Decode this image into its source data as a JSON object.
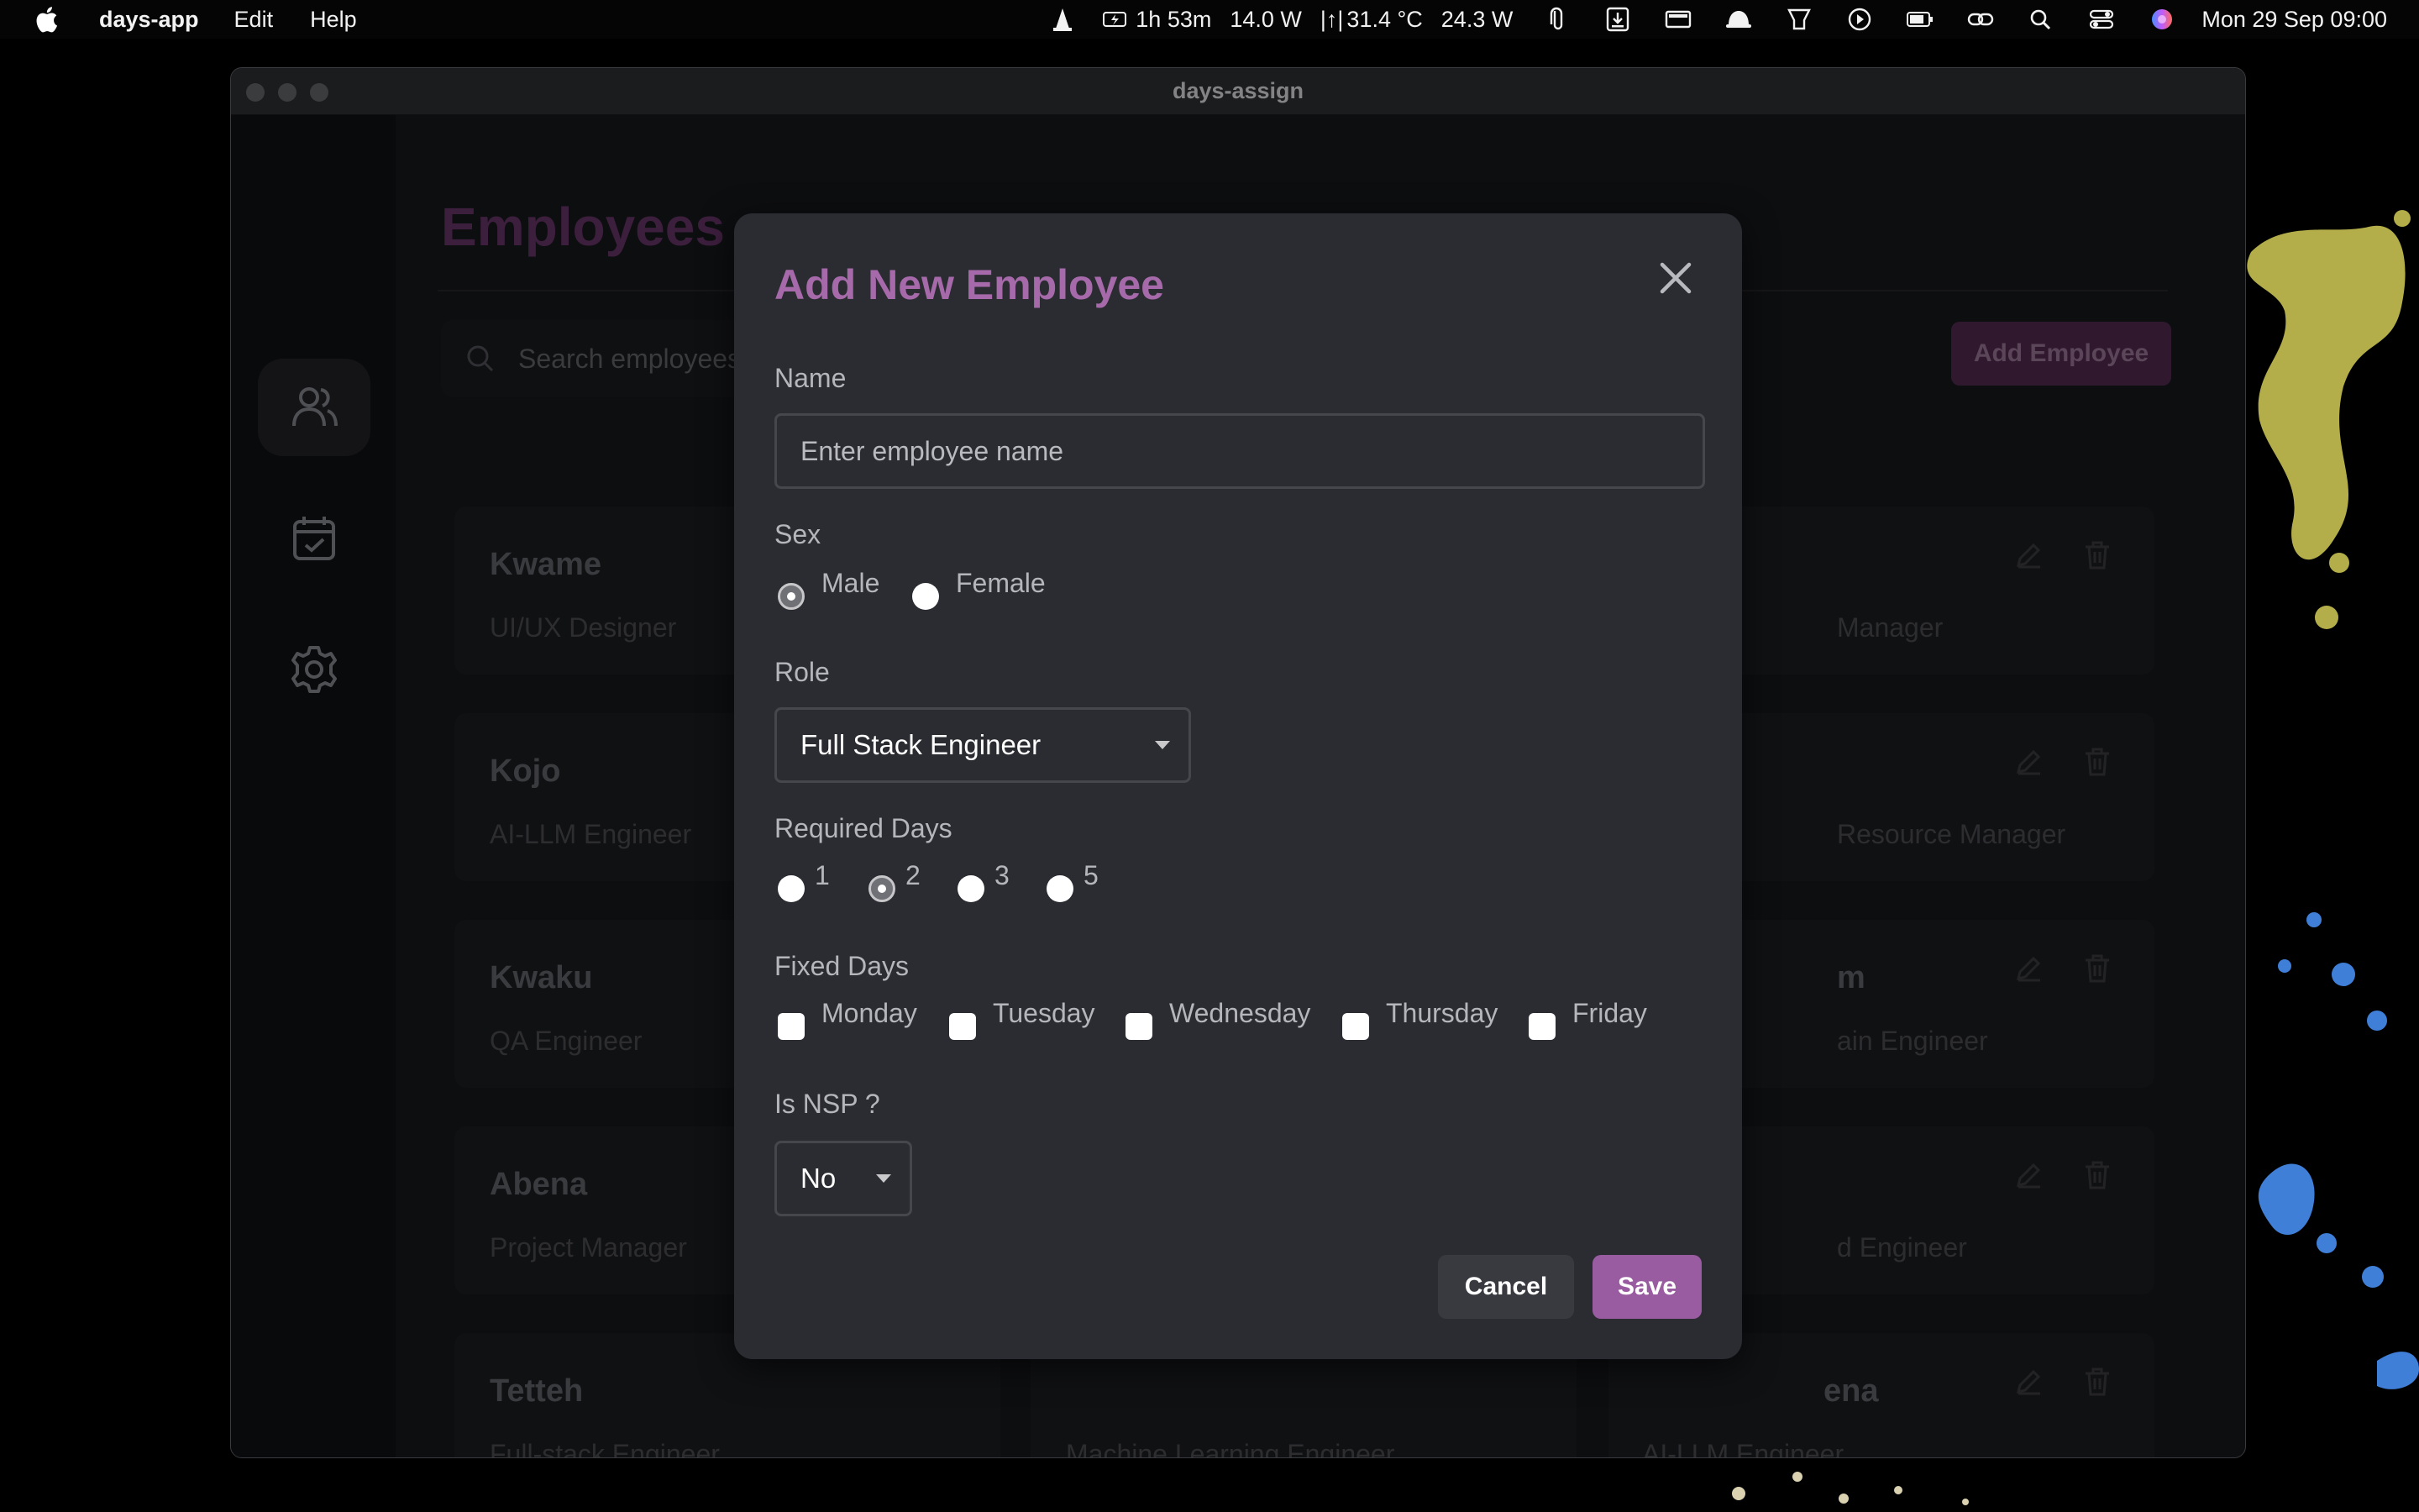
{
  "menubar": {
    "app_name": "days-app",
    "menus": [
      "Edit",
      "Help"
    ],
    "status": {
      "battery_time": "1h 53m",
      "power_in": "14.0 W",
      "temperature": "31.4 °C",
      "power_out": "24.3 W",
      "datetime": "Mon 29 Sep  09:00"
    }
  },
  "window": {
    "title": "days-assign"
  },
  "page": {
    "title": "Employees",
    "search_placeholder": "Search employees...",
    "add_button": "Add Employee"
  },
  "employees": [
    {
      "name": "Kwame",
      "role": "UI/UX Designer"
    },
    {
      "name": "",
      "role": "Manager"
    },
    {
      "name": "Kojo",
      "role": "AI-LLM Engineer"
    },
    {
      "name": "",
      "role": "Resource Manager"
    },
    {
      "name": "Kwaku",
      "role": "QA Engineer"
    },
    {
      "name": "m",
      "role": "ain Engineer"
    },
    {
      "name": "Abena",
      "role": "Project Manager"
    },
    {
      "name": "",
      "role": "d Engineer"
    },
    {
      "name": "Tetteh",
      "role": "Full-stack Engineer"
    },
    {
      "name": "",
      "role": "Machine Learning Engineer"
    },
    {
      "name": "ena",
      "role": "AI-LLM Engineer"
    }
  ],
  "modal": {
    "title": "Add New Employee",
    "name_label": "Name",
    "name_placeholder": "Enter employee name",
    "sex_label": "Sex",
    "sex_options": [
      "Male",
      "Female"
    ],
    "sex_selected": "Male",
    "role_label": "Role",
    "role_value": "Full Stack Engineer",
    "required_days_label": "Required Days",
    "required_days_options": [
      "1",
      "2",
      "3",
      "5"
    ],
    "required_days_selected": "2",
    "fixed_days_label": "Fixed Days",
    "fixed_days_options": [
      "Monday",
      "Tuesday",
      "Wednesday",
      "Thursday",
      "Friday"
    ],
    "nsp_label": "Is NSP ?",
    "nsp_value": "No",
    "cancel_label": "Cancel",
    "save_label": "Save"
  },
  "colors": {
    "accent": "#9a5ca0",
    "title_purple": "#a66aaa",
    "modal_bg": "#2b2c32",
    "window_bg": "#151619"
  },
  "icons": {
    "sidebar": [
      "users-icon",
      "calendar-check-icon",
      "gear-icon"
    ],
    "card_actions": [
      "edit-icon",
      "trash-icon"
    ]
  }
}
